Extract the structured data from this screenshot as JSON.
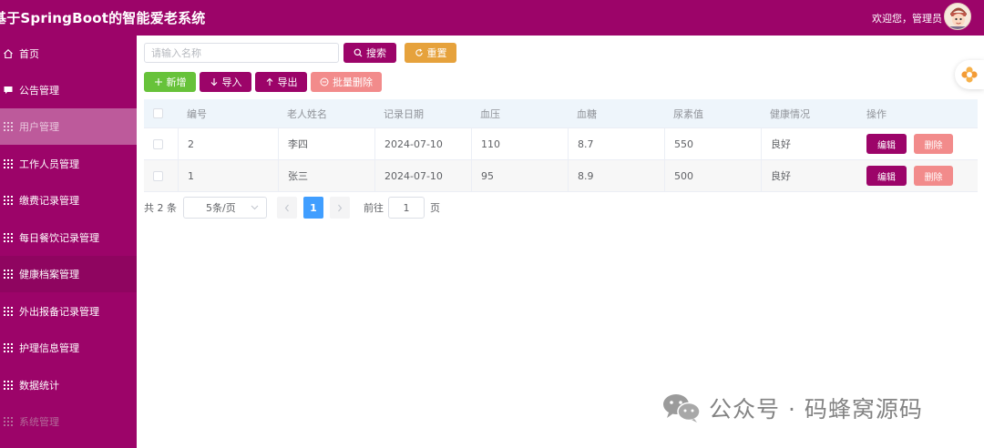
{
  "header": {
    "app_title": "基于SpringBoot的智能爱老系统",
    "welcome_text": "欢迎您，管理员"
  },
  "sidebar": {
    "items": [
      {
        "label": "首页",
        "icon": "home-icon"
      },
      {
        "label": "公告管理",
        "icon": "message-icon"
      },
      {
        "label": "用户管理",
        "icon": "grid-icon",
        "active": true
      },
      {
        "label": "工作人员管理",
        "icon": "grid-icon"
      },
      {
        "label": "缴费记录管理",
        "icon": "grid-icon"
      },
      {
        "label": "每日餐饮记录管理",
        "icon": "grid-icon"
      },
      {
        "label": "健康档案管理",
        "icon": "grid-icon"
      },
      {
        "label": "外出报备记录管理",
        "icon": "grid-icon"
      },
      {
        "label": "护理信息管理",
        "icon": "grid-icon"
      },
      {
        "label": "数据统计",
        "icon": "grid-icon"
      },
      {
        "label": "系统管理",
        "icon": "grid-icon"
      }
    ]
  },
  "toolbar": {
    "search_placeholder": "请输入名称",
    "search_value": "",
    "search_label": "搜索",
    "reset_label": "重置",
    "add_label": "新增",
    "import_label": "导入",
    "export_label": "导出",
    "batch_delete_label": "批量删除"
  },
  "table": {
    "columns": [
      "编号",
      "老人姓名",
      "记录日期",
      "血压",
      "血糖",
      "尿素值",
      "健康情况",
      "操作"
    ],
    "rows": [
      {
        "id": "2",
        "name": "李四",
        "date": "2024-07-10",
        "blood_pressure": "110",
        "blood_sugar": "8.7",
        "urea": "550",
        "health": "良好"
      },
      {
        "id": "1",
        "name": "张三",
        "date": "2024-07-10",
        "blood_pressure": "95",
        "blood_sugar": "8.9",
        "urea": "500",
        "health": "良好"
      }
    ],
    "edit_label": "编辑",
    "delete_label": "删除"
  },
  "pagination": {
    "total_text": "共 2 条",
    "page_size_text": "5条/页",
    "current_page": "1",
    "goto_label": "前往",
    "goto_value": "1",
    "page_suffix": "页"
  },
  "watermark": {
    "text": "公众号 · 码蜂窝源码"
  },
  "colors": {
    "brand": "#9c0469",
    "sidebar_active": "#bd5a9b",
    "add_green": "#67c23a",
    "reset_orange": "#e6a23c",
    "delete_red": "#f28b8b",
    "pager_blue": "#409eff"
  }
}
